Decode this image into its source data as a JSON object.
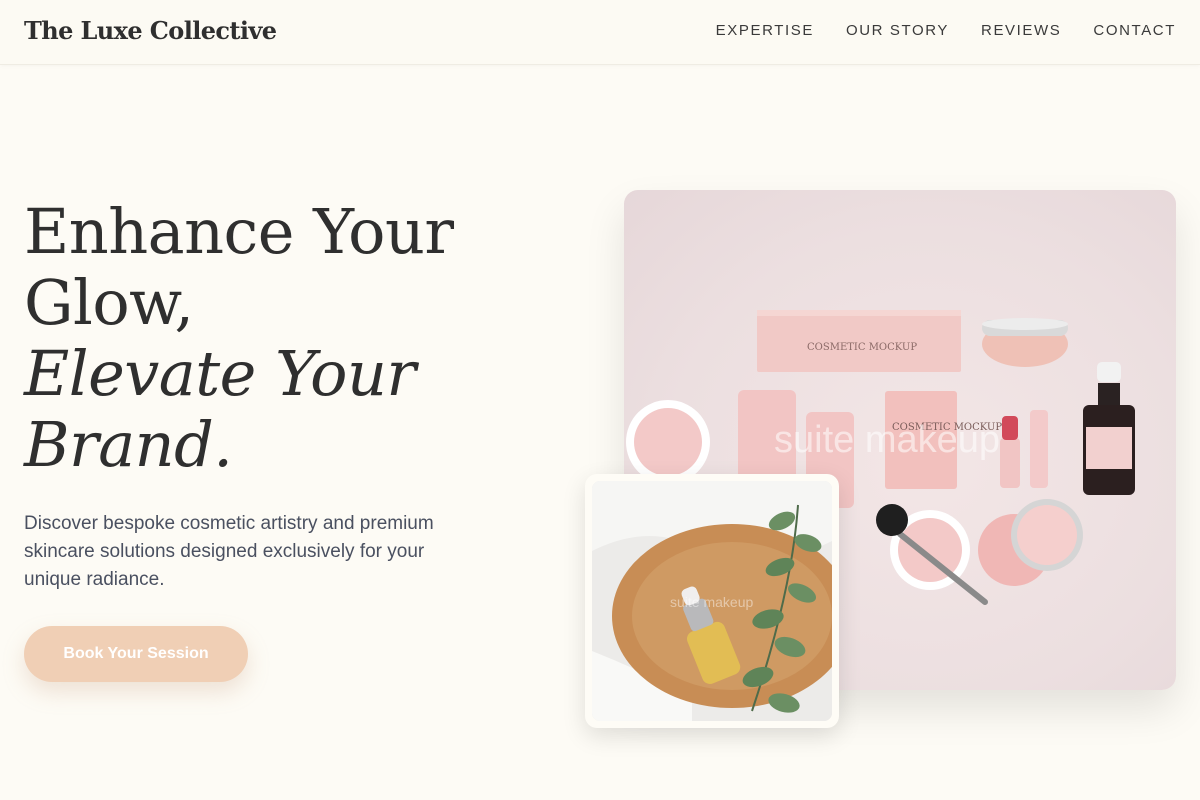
{
  "header": {
    "brand": "The Luxe Collective",
    "nav": [
      {
        "label": "EXPERTISE"
      },
      {
        "label": "OUR STORY"
      },
      {
        "label": "REVIEWS"
      },
      {
        "label": "CONTACT"
      }
    ]
  },
  "hero": {
    "title_line1": "Enhance Your",
    "title_line2": "Glow,",
    "title_line3": "Elevate Your",
    "title_line4": "Brand.",
    "subtitle": "Discover bespoke cosmetic artistry and premium skincare solutions designed exclusively for your unique radiance.",
    "cta_label": "Book Your Session"
  },
  "images": {
    "main_watermark": "suite makeup",
    "small_watermark": "suite makeup",
    "box_text": "COSMETIC MOCKUP",
    "sachet_text": "COSMETIC MOCKUP"
  },
  "colors": {
    "background": "#fdfbf5",
    "cta": "#f0cfb5",
    "text": "#2f2f2f"
  }
}
